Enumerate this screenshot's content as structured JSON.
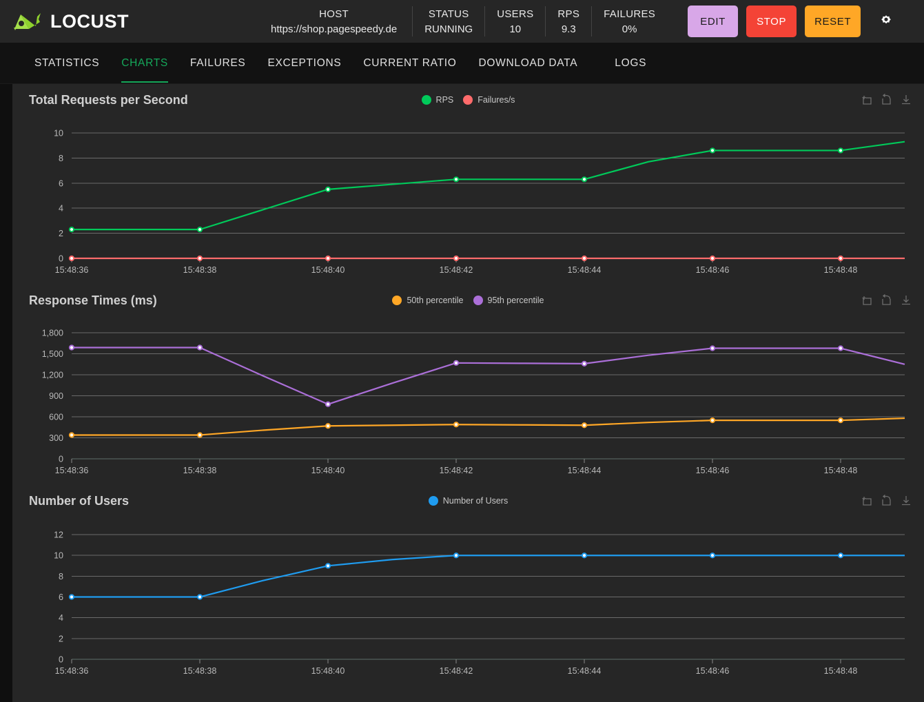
{
  "header": {
    "brand": "LOCUST",
    "logo_icon": "locust-logo-icon",
    "stats": [
      {
        "label": "HOST",
        "value": "https://shop.pagespeedy.de"
      },
      {
        "label": "STATUS",
        "value": "RUNNING"
      },
      {
        "label": "USERS",
        "value": "10"
      },
      {
        "label": "RPS",
        "value": "9.3"
      },
      {
        "label": "FAILURES",
        "value": "0%"
      }
    ],
    "buttons": {
      "edit": "EDIT",
      "stop": "STOP",
      "reset": "RESET"
    },
    "settings_icon": "gear-icon",
    "colors": {
      "edit": "#d8a7e8",
      "stop": "#f44336",
      "reset": "#ffa726",
      "bar_bg": "#262626"
    }
  },
  "tabs": {
    "items": [
      {
        "label": "STATISTICS",
        "active": false
      },
      {
        "label": "CHARTS",
        "active": true
      },
      {
        "label": "FAILURES",
        "active": false
      },
      {
        "label": "EXCEPTIONS",
        "active": false
      },
      {
        "label": "CURRENT RATIO",
        "active": false
      },
      {
        "label": "DOWNLOAD DATA",
        "active": false
      },
      {
        "label": "LOGS",
        "active": false
      }
    ],
    "active_color": "#15a85a"
  },
  "chart_tools": {
    "zoom_reset": "box-zoom-icon",
    "restore": "restore-undo-icon",
    "download": "download-icon"
  },
  "chart_data": [
    {
      "type": "line",
      "title": "Total Requests per Second",
      "xlabel": "",
      "ylabel": "",
      "grid": true,
      "legend_position": "top-center",
      "x": [
        "15:48:36",
        "15:48:37",
        "15:48:38",
        "15:48:39",
        "15:48:40",
        "15:48:41",
        "15:48:42",
        "15:48:43",
        "15:48:44",
        "15:48:45",
        "15:48:46",
        "15:48:47",
        "15:48:48",
        "15:48:49"
      ],
      "xticks": [
        "15:48:36",
        "15:48:38",
        "15:48:40",
        "15:48:42",
        "15:48:44",
        "15:48:46",
        "15:48:48"
      ],
      "yticks": [
        0,
        2,
        4,
        6,
        8,
        10
      ],
      "ylim": [
        0,
        10.6
      ],
      "series": [
        {
          "name": "RPS",
          "color": "#00ca5a",
          "values": [
            2.3,
            2.3,
            2.3,
            3.9,
            5.5,
            5.9,
            6.3,
            6.3,
            6.3,
            7.7,
            8.6,
            8.6,
            8.6,
            9.3
          ]
        },
        {
          "name": "Failures/s",
          "color": "#ff6b6b",
          "values": [
            0,
            0,
            0,
            0,
            0,
            0,
            0,
            0,
            0,
            0,
            0,
            0,
            0,
            0
          ]
        }
      ]
    },
    {
      "type": "line",
      "title": "Response Times (ms)",
      "xlabel": "",
      "ylabel": "",
      "grid": true,
      "legend_position": "top-center",
      "x": [
        "15:48:36",
        "15:48:37",
        "15:48:38",
        "15:48:39",
        "15:48:40",
        "15:48:41",
        "15:48:42",
        "15:48:43",
        "15:48:44",
        "15:48:45",
        "15:48:46",
        "15:48:47",
        "15:48:48",
        "15:48:49"
      ],
      "xticks": [
        "15:48:36",
        "15:48:38",
        "15:48:40",
        "15:48:42",
        "15:48:44",
        "15:48:46",
        "15:48:48"
      ],
      "yticks": [
        0,
        300,
        600,
        900,
        1200,
        1500,
        1800
      ],
      "ytick_labels": [
        "0",
        "300",
        "600",
        "900",
        "1,200",
        "1,500",
        "1,800"
      ],
      "ylim": [
        0,
        1900
      ],
      "series": [
        {
          "name": "50th percentile",
          "color": "#ffa726",
          "values": [
            340,
            340,
            340,
            410,
            470,
            480,
            490,
            485,
            480,
            520,
            550,
            550,
            550,
            580
          ]
        },
        {
          "name": "95th percentile",
          "color": "#ab6fd8",
          "values": [
            1590,
            1590,
            1590,
            1180,
            780,
            1080,
            1370,
            1365,
            1360,
            1480,
            1580,
            1580,
            1580,
            1350
          ]
        }
      ]
    },
    {
      "type": "line",
      "title": "Number of Users",
      "xlabel": "",
      "ylabel": "",
      "grid": true,
      "legend_position": "top-center",
      "x": [
        "15:48:36",
        "15:48:37",
        "15:48:38",
        "15:48:39",
        "15:48:40",
        "15:48:41",
        "15:48:42",
        "15:48:43",
        "15:48:44",
        "15:48:45",
        "15:48:46",
        "15:48:47",
        "15:48:48",
        "15:48:49"
      ],
      "xticks": [
        "15:48:36",
        "15:48:38",
        "15:48:40",
        "15:48:42",
        "15:48:44",
        "15:48:46",
        "15:48:48"
      ],
      "yticks": [
        0,
        2,
        4,
        6,
        8,
        10,
        12
      ],
      "ylim": [
        0,
        12.8
      ],
      "series": [
        {
          "name": "Number of Users",
          "color": "#1f9cf0",
          "values": [
            6,
            6,
            6,
            7.6,
            9,
            9.6,
            10,
            10,
            10,
            10,
            10,
            10,
            10,
            10
          ]
        }
      ]
    }
  ]
}
